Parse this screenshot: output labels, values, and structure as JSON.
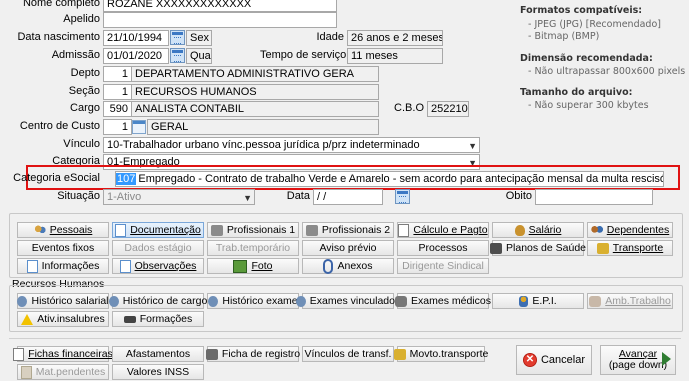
{
  "form": {
    "nome_label": "Nome completo",
    "nome_value": "ROZANE XXXXXXXXXXXXX",
    "apelido_label": "Apelido",
    "nasc_label": "Data nascimento",
    "nasc_value": "21/10/1994",
    "nasc_dow": "Sex",
    "idade_label": "Idade",
    "idade_value": "26 anos e 2 meses",
    "admissao_label": "Admissão",
    "admissao_value": "01/01/2020",
    "admissao_dow": "Qua",
    "tempo_label": "Tempo de serviço",
    "tempo_value": "11 meses",
    "depto_label": "Depto",
    "depto_code": "1",
    "depto_value": "DEPARTAMENTO ADMINISTRATIVO GERA",
    "secao_label": "Seção",
    "secao_code": "1",
    "secao_value": "RECURSOS HUMANOS",
    "cargo_label": "Cargo",
    "cargo_code": "590",
    "cargo_value": "ANALISTA CONTABIL",
    "cbo_label": "C.B.O",
    "cbo_value": "252210",
    "cc_label": "Centro de Custo",
    "cc_code": "1",
    "cc_value": "GERAL",
    "vinculo_label": "Vínculo",
    "vinculo_value": "10-Trabalhador urbano vínc.pessoa jurídica p/prz indeterminado",
    "categoria_label": "Categoria",
    "categoria_value": "01-Empregado",
    "cat_esocial_label": "Categoria eSocial",
    "cat_esocial_code": "107",
    "cat_esocial_value": "Empregado - Contrato de trabalho Verde e Amarelo - sem acordo para antecipação mensal da multa rescisória do FGTS",
    "situacao_label": "Situação",
    "situacao_value": "1-Ativo",
    "data_label": "Data",
    "data_value": " /  /",
    "obito_label": "Obito"
  },
  "right_panel": {
    "formats_title": "Formatos compatíveis:",
    "formats": [
      "- JPEG (JPG) [Recomendado]",
      "- Bitmap (BMP)"
    ],
    "dimension_title": "Dimensão recomendada:",
    "dimension": "- Não ultrapassar 800x600 pixels",
    "size_title": "Tamanho do arquivo:",
    "size": "- Não superar 300 kbytes"
  },
  "buttons_main": [
    [
      "Pessoais",
      "Documentação",
      "Profissionais 1",
      "Profissionais 2",
      "Cálculo e Pagto",
      "Salário",
      "Dependentes"
    ],
    [
      "Eventos fixos",
      "Dados estágio",
      "Trab.temporário",
      "Aviso prévio",
      "Processos",
      "Planos de Saúde",
      "Transporte"
    ],
    [
      "Informações",
      "Observações",
      "Foto",
      "Anexos",
      "Dirigente Sindical"
    ]
  ],
  "rh_title": "Recursos Humanos",
  "buttons_rh": [
    [
      "Histórico salarial",
      "Histórico de cargo",
      "Histórico exame",
      "Exames vinculados",
      "Exames médicos",
      "E.P.I.",
      "Amb.Trabalho"
    ],
    [
      "Ativ.insalubres",
      "Formações"
    ]
  ],
  "buttons_bottom": [
    [
      "Fichas financeiras",
      "Afastamentos",
      "Ficha de registro",
      "Vínculos de transf.",
      "Movto.transporte"
    ],
    [
      "Mat.pendentes",
      "Valores INSS"
    ]
  ],
  "cancel_label": "Cancelar",
  "advance_label_1": "Avançar",
  "advance_label_2": "(page down)",
  "colors": {
    "highlight_border": "#e01212",
    "selected_code_bg": "#3399ff",
    "code_bg": "#ffff66"
  }
}
